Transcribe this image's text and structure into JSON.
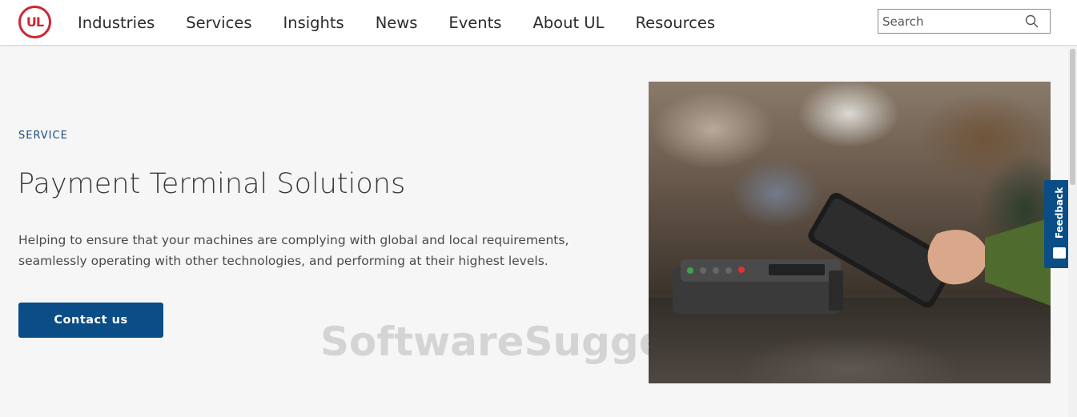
{
  "header": {
    "logo_text": "UL",
    "nav": [
      "Industries",
      "Services",
      "Insights",
      "News",
      "Events",
      "About UL",
      "Resources"
    ],
    "search_placeholder": "Search"
  },
  "hero": {
    "eyebrow": "SERVICE",
    "title": "Payment Terminal Solutions",
    "description": "Helping to ensure that your machines are complying with global and local requirements, seamlessly operating with other technologies, and performing at their highest levels.",
    "cta_label": "Contact us"
  },
  "watermark": "SoftwareSugge",
  "feedback_tab": {
    "label": "Feedback"
  },
  "colors": {
    "brand_red": "#ca2833",
    "brand_blue": "#0b4d86",
    "eyebrow_blue": "#1b4d7e"
  },
  "icons": {
    "search": "search-icon",
    "feedback": "feedback-smiley-icon"
  }
}
